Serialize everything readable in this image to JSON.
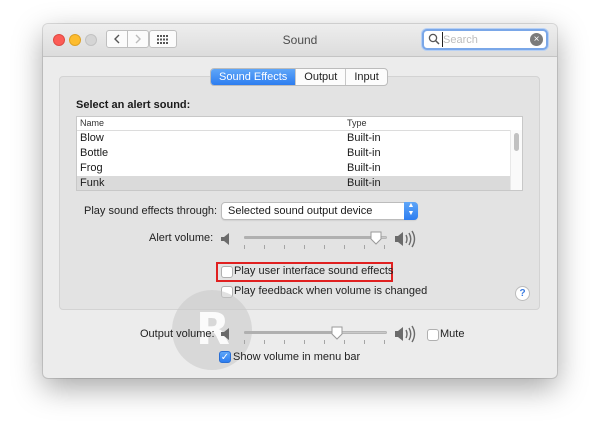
{
  "window": {
    "title": "Sound"
  },
  "toolbar": {
    "back_icon": "chevron-left-icon",
    "forward_icon": "chevron-right-icon",
    "grid_icon": "grid-icon"
  },
  "search": {
    "placeholder": "Search",
    "value": "",
    "icon": "search-icon",
    "clear_icon": "clear-icon"
  },
  "tabs": [
    {
      "label": "Sound Effects",
      "active": true
    },
    {
      "label": "Output",
      "active": false
    },
    {
      "label": "Input",
      "active": false
    }
  ],
  "alert_section": {
    "label": "Select an alert sound:",
    "columns": [
      "Name",
      "Type"
    ],
    "rows": [
      {
        "name": "Blow",
        "type": "Built-in",
        "selected": false
      },
      {
        "name": "Bottle",
        "type": "Built-in",
        "selected": false
      },
      {
        "name": "Frog",
        "type": "Built-in",
        "selected": false
      },
      {
        "name": "Funk",
        "type": "Built-in",
        "selected": true
      }
    ]
  },
  "play_through": {
    "label": "Play sound effects through:",
    "selected": "Selected sound output device"
  },
  "alert_volume": {
    "label": "Alert volume:",
    "level": 0.92
  },
  "options": {
    "ui_sound_effects": {
      "label": "Play user interface sound effects",
      "checked": false
    },
    "volume_feedback": {
      "label": "Play feedback when volume is changed",
      "checked": false
    }
  },
  "help": {
    "label": "?"
  },
  "output": {
    "label": "Output volume:",
    "level": 0.65,
    "mute_label": "Mute",
    "mute_checked": false
  },
  "menu_bar": {
    "label": "Show volume in menu bar",
    "checked": true
  },
  "colors": {
    "accent": "#2d7df0",
    "highlight_border": "#e02020"
  },
  "watermark": {
    "letter": "R"
  }
}
